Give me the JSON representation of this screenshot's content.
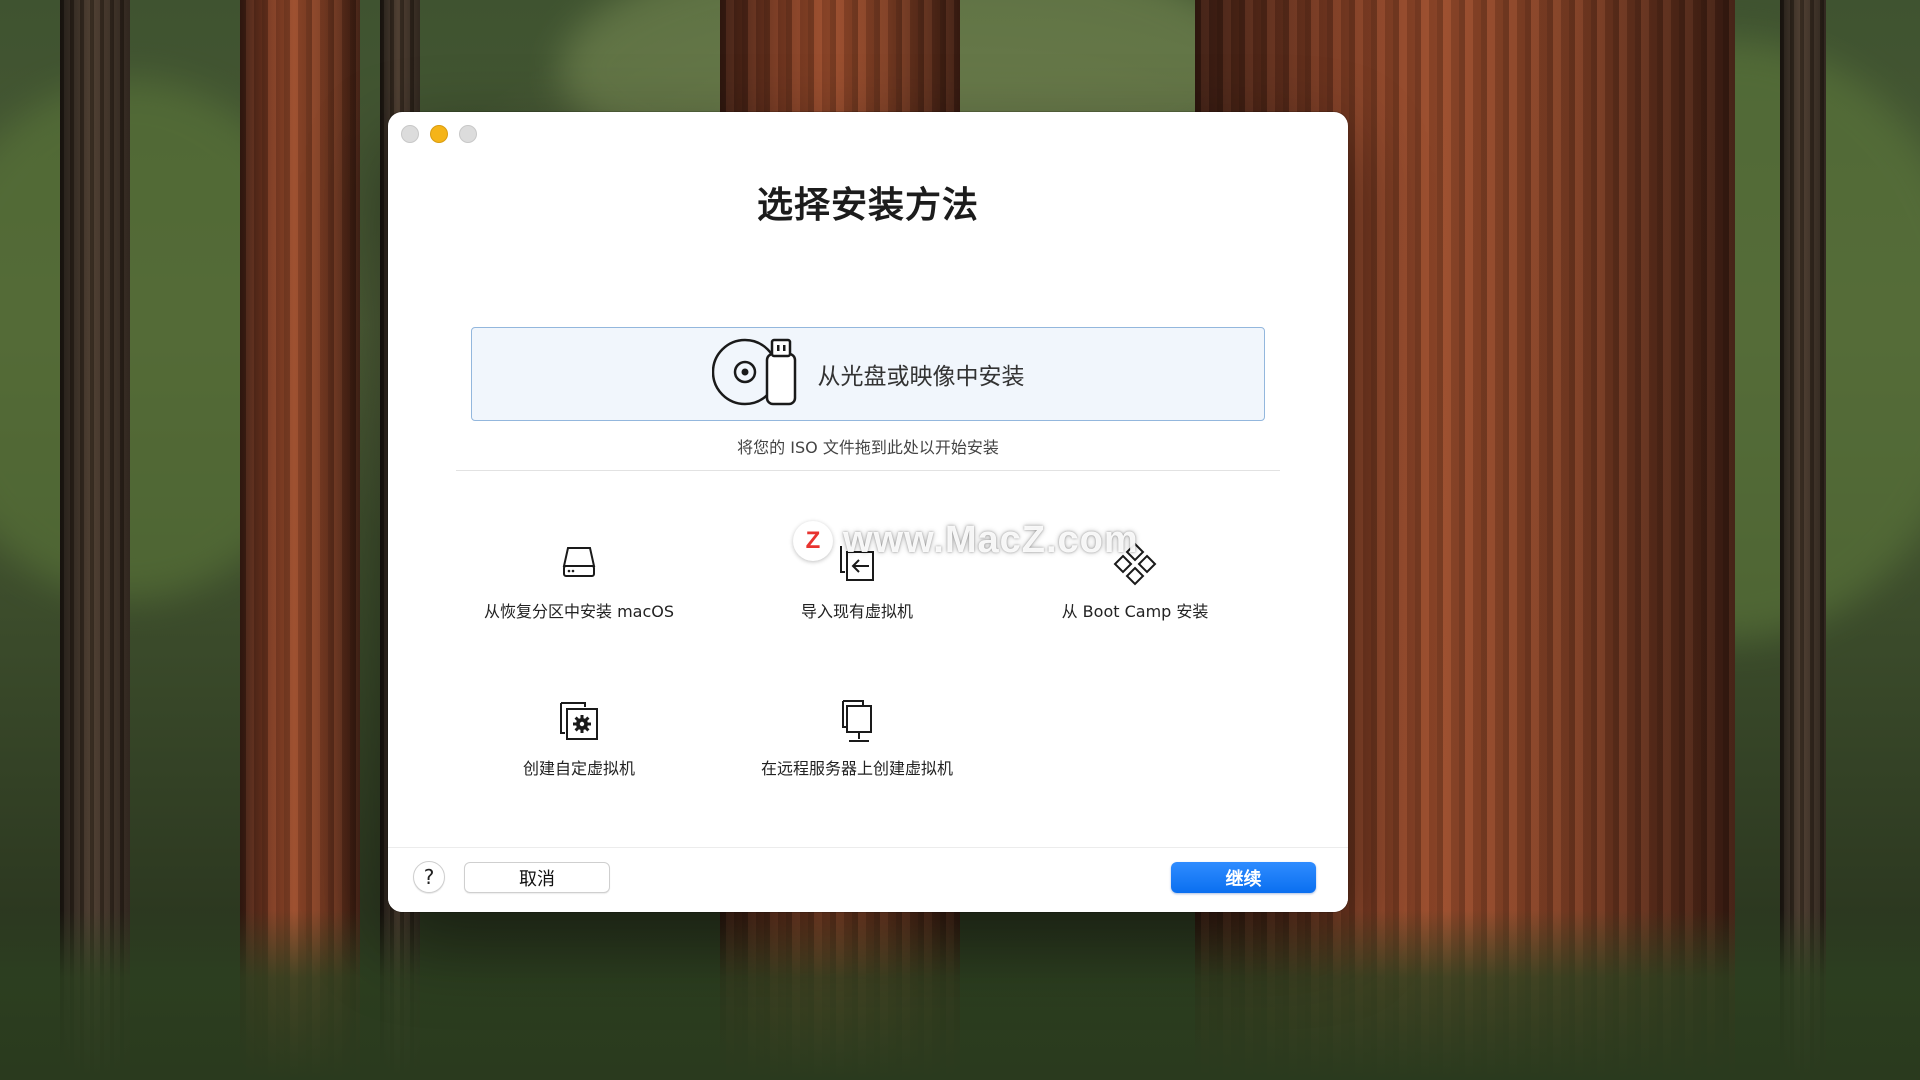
{
  "window": {
    "title": "选择安装方法"
  },
  "dropzone": {
    "icon": "disc-and-usb-icon",
    "label": "从光盘或映像中安装",
    "hint": "将您的 ISO 文件拖到此处以开始安装"
  },
  "options": [
    {
      "icon": "hard-drive-icon",
      "label": "从恢复分区中安装 macOS"
    },
    {
      "icon": "import-vm-icon",
      "label": "导入现有虚拟机"
    },
    {
      "icon": "boot-camp-icon",
      "label": "从 Boot Camp 安装"
    },
    {
      "icon": "custom-vm-gear-icon",
      "label": "创建自定虚拟机"
    },
    {
      "icon": "remote-server-icon",
      "label": "在远程服务器上创建虚拟机"
    }
  ],
  "watermark": {
    "badge": "Z",
    "text": "www.MacZ.com"
  },
  "footer": {
    "help_label": "?",
    "cancel_label": "取消",
    "continue_label": "继续"
  },
  "colors": {
    "accent": "#0a6ff0",
    "dropzone_border": "#93b7dd",
    "minimize_yellow": "#f5b418"
  }
}
